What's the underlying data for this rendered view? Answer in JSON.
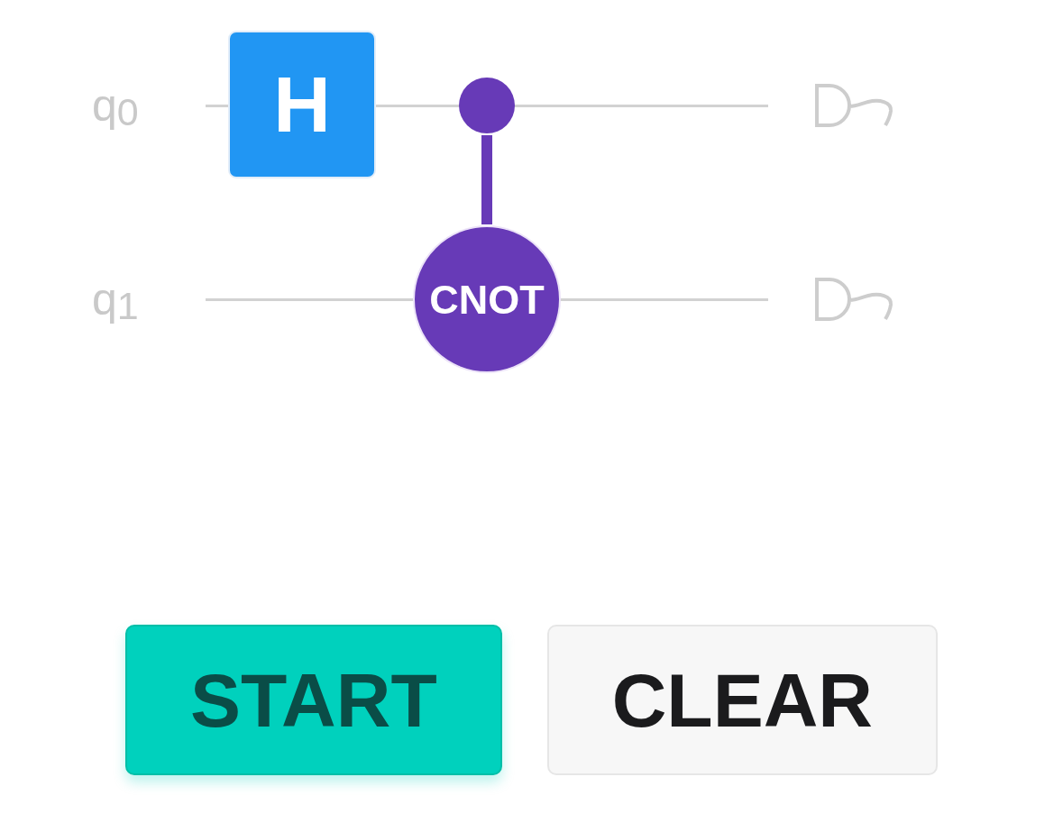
{
  "circuit": {
    "wires": [
      {
        "label": "q$_{0}$",
        "slots": [
          {
            "kind": "gate",
            "label": "H"
          },
          {
            "kind": "control"
          }
        ],
        "measured": true
      },
      {
        "label": "q$_{1}$",
        "slots": [
          {
            "kind": "empty"
          },
          {
            "kind": "target",
            "label": "CNOT"
          }
        ],
        "measured": true
      }
    ]
  },
  "buttons": [
    {
      "label": "START",
      "kind": "primary"
    },
    {
      "label": "CLEAR",
      "kind": "secondary"
    }
  ]
}
